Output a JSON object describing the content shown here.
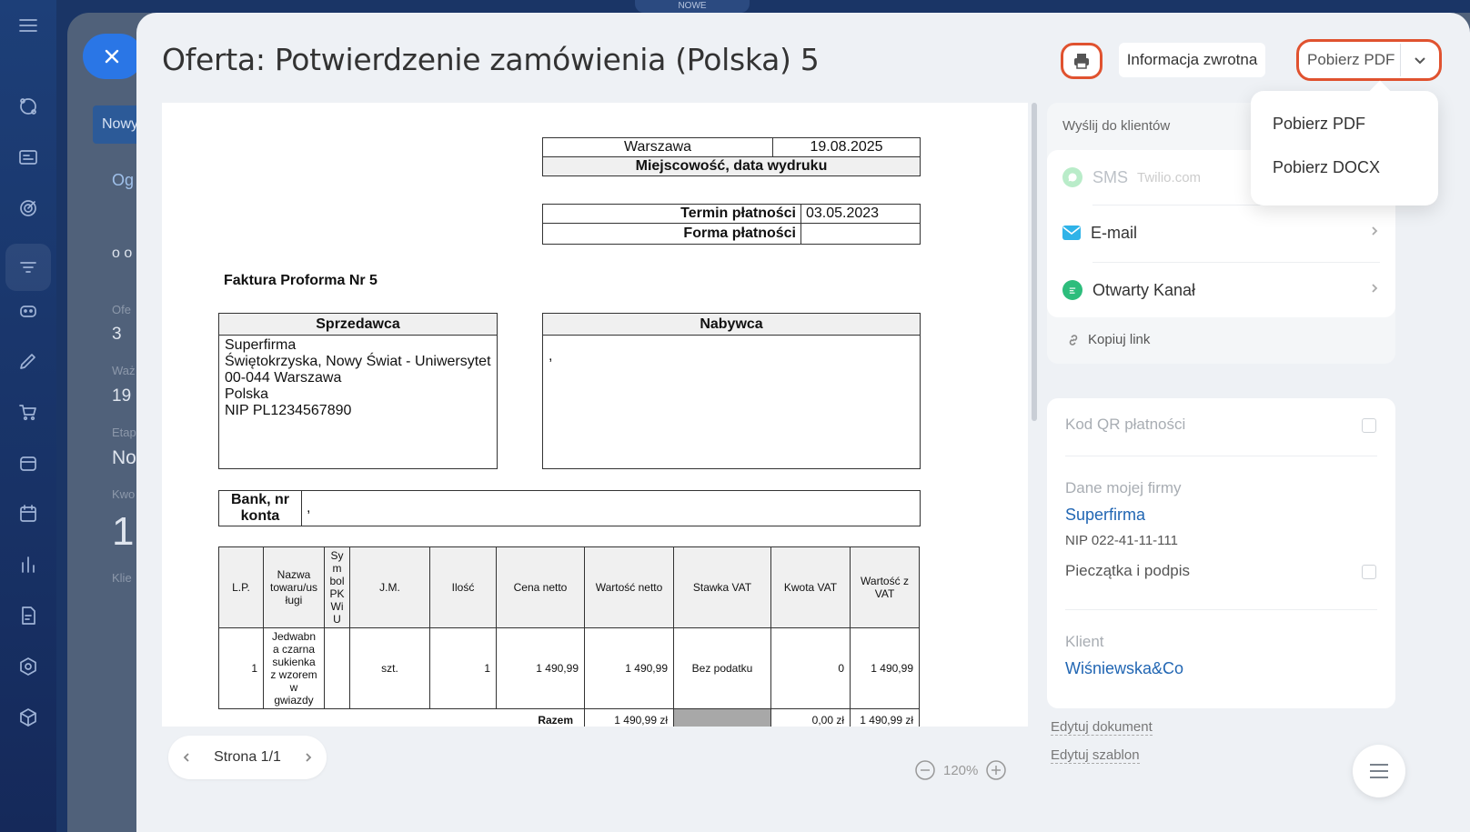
{
  "topbar": {
    "pill_label": "NOWE"
  },
  "background_page": {
    "new_button": "Nowy",
    "tab": "Og",
    "row1": "o o",
    "label1": "Ofe",
    "value1": "3",
    "label2": "Waż",
    "value2": "19",
    "label3": "Etap",
    "value3": "No",
    "label4": "Kwo",
    "value4": "1",
    "label5": "Klie"
  },
  "header": {
    "title": "Oferta: Potwierdzenie zamówienia (Polska) 5",
    "feedback_label": "Informacja zwrotna",
    "download_label": "Pobierz PDF"
  },
  "dropdown": {
    "items": [
      "Pobierz PDF",
      "Pobierz DOCX"
    ]
  },
  "document": {
    "city": "Warszawa",
    "print_date": "19.08.2025",
    "place_date_label": "Miejscowość, data wydruku",
    "payment_due_label": "Termin płatności",
    "payment_due": "03.05.2023",
    "payment_method_label": "Forma płatności",
    "payment_method": "",
    "proforma_title": "Faktura Proforma Nr 5",
    "seller_label": "Sprzedawca",
    "seller_lines": [
      "Superfirma",
      "Świętokrzyska, Nowy Świat - Uniwersytet",
      "00-044 Warszawa",
      "Polska",
      "NIP PL1234567890"
    ],
    "buyer_label": "Nabywca",
    "buyer_text": ",",
    "bank_label_1": "Bank, nr",
    "bank_label_2": "konta",
    "bank_value": ",",
    "items_headers": [
      "L.P.",
      "Nazwa towaru/usługi",
      "Symbol PKWiU",
      "J.M.",
      "Ilość",
      "Cena netto",
      "Wartość netto",
      "Stawka VAT",
      "Kwota VAT",
      "Wartość z VAT"
    ],
    "items_headers_display": {
      "name": "Nazwa\ntowaru/us\nługi",
      "pkwiu": "Sy\nm\nbol\nPK\nWi\nU"
    },
    "rows": [
      {
        "lp": "1",
        "name": "Jedwabn\na czarna\nsukienka\nz wzorem\nw\ngwiazdy",
        "pkwiu": "",
        "jm": "szt.",
        "qty": "1",
        "net_price": "1 490,99",
        "net_value": "1 490,99",
        "vat_rate": "Bez podatku",
        "vat_amount": "0",
        "gross_value": "1 490,99"
      }
    ],
    "total_label": "Razem",
    "total_net": "1 490,99 zł",
    "total_vat": "0,00 zł",
    "total_gross": "1 490,99 zł"
  },
  "pager": {
    "label": "Strona 1/1"
  },
  "zoom": {
    "level": "120%"
  },
  "send_panel": {
    "title": "Wyślij do klientów",
    "sms_label": "SMS",
    "sms_provider": "Twilio.com",
    "email_label": "E-mail",
    "open_channel_label": "Otwarty Kanał",
    "copy_link_label": "Kopiuj link"
  },
  "info_panel": {
    "qr_label": "Kod QR płatności",
    "company_data_label": "Dane mojej firmy",
    "company_name": "Superfirma",
    "company_nip": "NIP 022-41-11-111",
    "stamp_label": "Pieczątka i podpis",
    "client_label": "Klient",
    "client_name": "Wiśniewska&Co"
  },
  "links": {
    "edit_document": "Edytuj dokument",
    "edit_template": "Edytuj szablon"
  },
  "colors": {
    "accent_red": "#e0522f",
    "link_blue": "#2166b3",
    "close_blue": "#2a76e6",
    "whatsapp_green": "#25d366",
    "email_blue": "#2fb3e8",
    "channel_green": "#2dbd7c"
  }
}
